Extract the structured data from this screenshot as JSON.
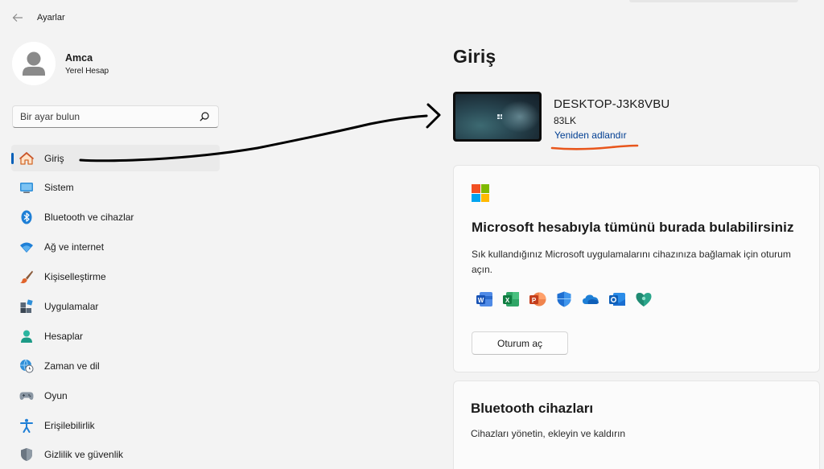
{
  "window": {
    "title": "Ayarlar",
    "back_icon": "arrow-left-icon"
  },
  "profile": {
    "name": "Amca",
    "account_type": "Yerel Hesap"
  },
  "search": {
    "placeholder": "Bir ayar bulun",
    "value": ""
  },
  "sidebar": {
    "items": [
      {
        "label": "Giriş",
        "icon": "home-icon",
        "active": true
      },
      {
        "label": "Sistem",
        "icon": "monitor-icon"
      },
      {
        "label": "Bluetooth ve cihazlar",
        "icon": "bluetooth-icon"
      },
      {
        "label": "Ağ ve internet",
        "icon": "wifi-icon"
      },
      {
        "label": "Kişiselleştirme",
        "icon": "brush-icon"
      },
      {
        "label": "Uygulamalar",
        "icon": "apps-icon"
      },
      {
        "label": "Hesaplar",
        "icon": "person-icon"
      },
      {
        "label": "Zaman ve dil",
        "icon": "globe-clock-icon"
      },
      {
        "label": "Oyun",
        "icon": "gamepad-icon"
      },
      {
        "label": "Erişilebilirlik",
        "icon": "accessibility-icon"
      },
      {
        "label": "Gizlilik ve güvenlik",
        "icon": "shield-icon"
      }
    ]
  },
  "main": {
    "title": "Giriş",
    "device": {
      "name": "DESKTOP-J3K8VBU",
      "model": "83LK",
      "rename_label": "Yeniden adlandır"
    },
    "ms_card": {
      "title": "Microsoft hesabıyla tümünü burada bulabilirsiniz",
      "description": "Sık kullandığınız Microsoft uygulamalarını cihazınıza bağlamak için oturum açın.",
      "apps": [
        "word-icon",
        "excel-icon",
        "powerpoint-icon",
        "defender-icon",
        "onedrive-icon",
        "outlook-icon",
        "family-safety-icon"
      ],
      "signin_label": "Oturum aç"
    },
    "bt_card": {
      "title": "Bluetooth cihazları",
      "description": "Cihazları yönetin, ekleyin ve kaldırın"
    }
  },
  "colors": {
    "accent": "#005fb8",
    "link": "#003e92",
    "annotation_arrow": "#000000",
    "annotation_underline": "#e8561c"
  }
}
